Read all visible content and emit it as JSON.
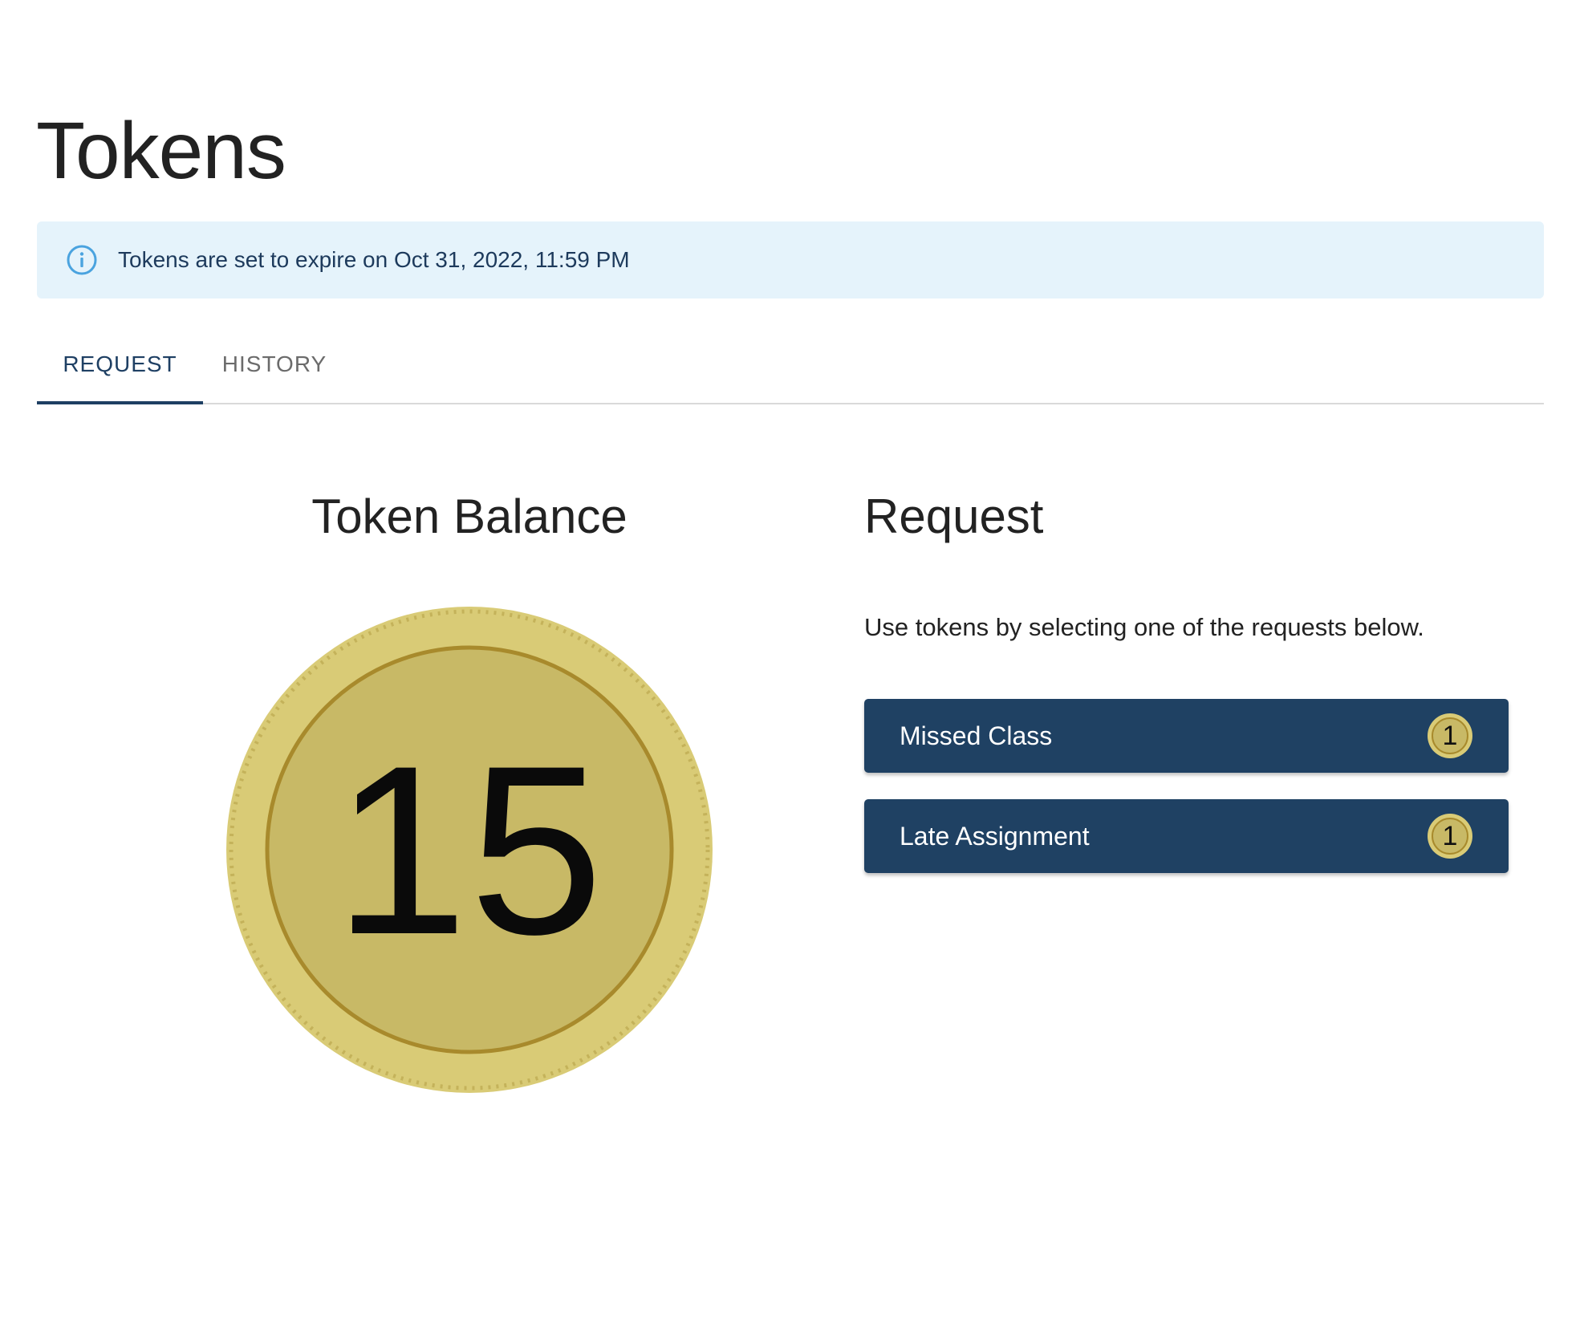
{
  "page": {
    "title": "Tokens"
  },
  "banner": {
    "icon": "info-icon",
    "text": "Tokens are set to expire on Oct 31, 2022, 11:59 PM",
    "color": "#e5f3fb"
  },
  "tabs": [
    {
      "label": "REQUEST",
      "active": true
    },
    {
      "label": "HISTORY",
      "active": false
    }
  ],
  "balance": {
    "heading": "Token Balance",
    "value": "15"
  },
  "request": {
    "heading": "Request",
    "description": "Use tokens by selecting one of the requests below.",
    "items": [
      {
        "label": "Missed Class",
        "cost": "1"
      },
      {
        "label": "Late Assignment",
        "cost": "1"
      }
    ]
  },
  "colors": {
    "primary": "#1f4163",
    "coin_outer": "#d9cb76",
    "coin_inner": "#c8b966",
    "coin_ring": "#a88a2c",
    "info": "#4aa3df"
  }
}
